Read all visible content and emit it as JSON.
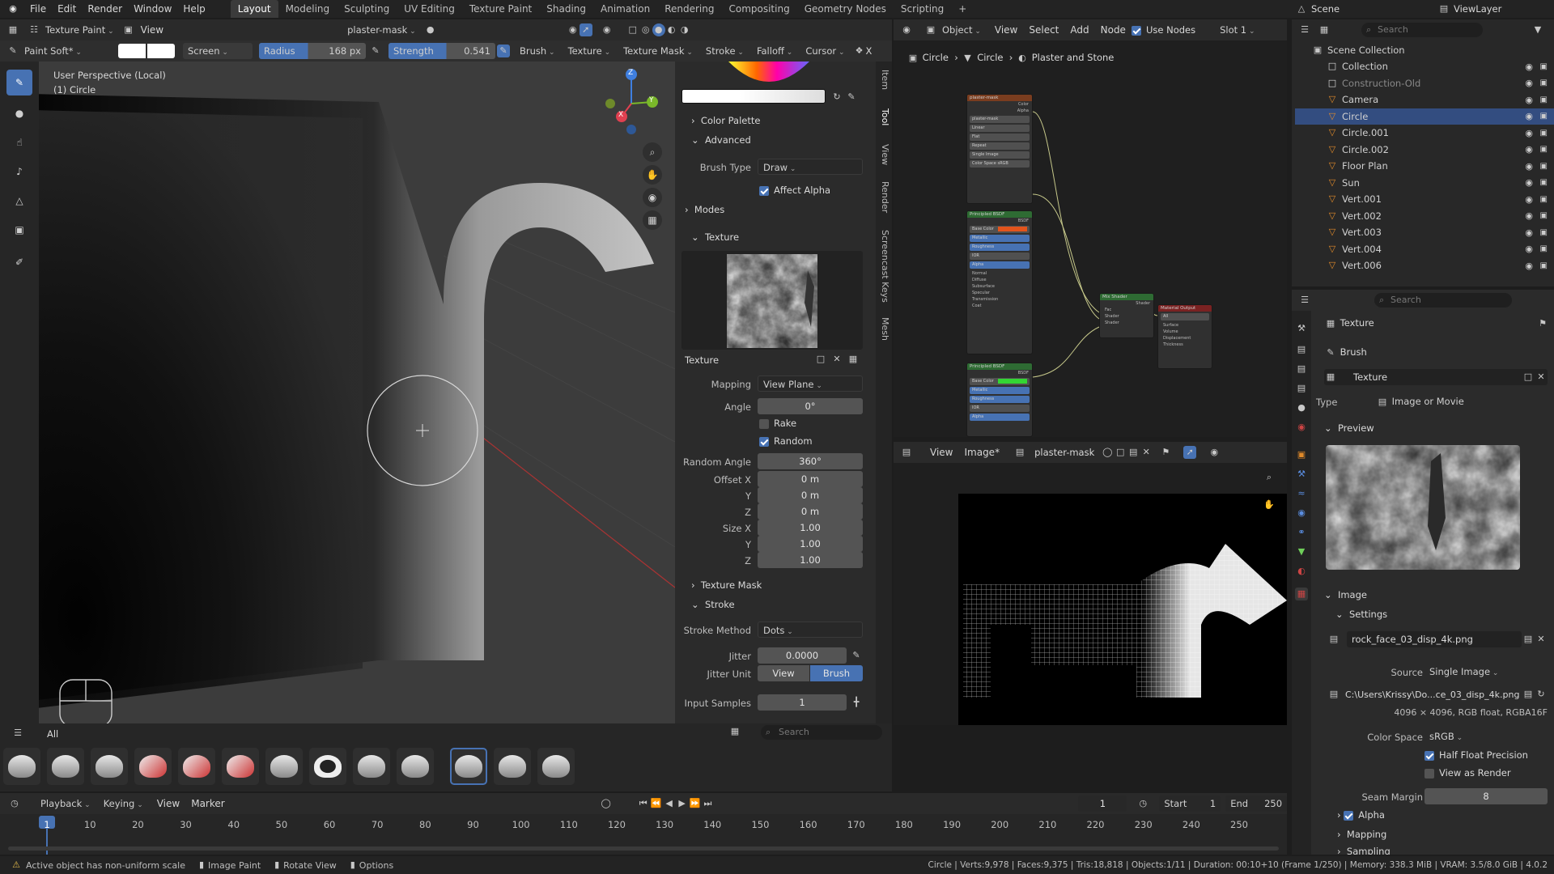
{
  "menu": [
    "File",
    "Edit",
    "Render",
    "Window",
    "Help"
  ],
  "workspaces": [
    "Layout",
    "Modeling",
    "Sculpting",
    "UV Editing",
    "Texture Paint",
    "Shading",
    "Animation",
    "Rendering",
    "Compositing",
    "Geometry Nodes",
    "Scripting"
  ],
  "active_workspace": "Layout",
  "scene": {
    "name": "Scene",
    "view_layer": "ViewLayer"
  },
  "viewport_header": {
    "mode": "Texture Paint",
    "view": "View",
    "image": "plaster-mask"
  },
  "tool_settings": {
    "brush_name": "Paint Soft*",
    "blend": "Screen",
    "radius_label": "Radius",
    "radius_value": "168 px",
    "strength_label": "Strength",
    "strength_value": "0.541",
    "menus": [
      "Brush",
      "Texture",
      "Texture Mask",
      "Stroke",
      "Falloff",
      "Cursor"
    ]
  },
  "viewport": {
    "title": "User Perspective (Local)",
    "object": "(1) Circle"
  },
  "gizmo": {
    "x": "X",
    "y": "Y",
    "z": "Z"
  },
  "n_panel": {
    "tabs": [
      "Item",
      "Tool",
      "View",
      "Render",
      "Screencast Keys",
      "Mesh"
    ],
    "color_palette": "Color Palette",
    "advanced": "Advanced",
    "brush_type_label": "Brush Type",
    "brush_type": "Draw",
    "affect_alpha": "Affect Alpha",
    "modes": "Modes",
    "texture_section": "Texture",
    "texture_name": "Texture",
    "mapping_label": "Mapping",
    "mapping": "View Plane",
    "angle_label": "Angle",
    "angle": "0°",
    "rake": "Rake",
    "random": "Random",
    "random_angle_label": "Random Angle",
    "random_angle": "360°",
    "offset_x_label": "Offset X",
    "offset_x": "0 m",
    "offset_y_label": "Y",
    "offset_y": "0 m",
    "offset_z_label": "Z",
    "offset_z": "0 m",
    "size_x_label": "Size X",
    "size_x": "1.00",
    "size_y_label": "Y",
    "size_y": "1.00",
    "size_z_label": "Z",
    "size_z": "1.00",
    "texture_mask": "Texture Mask",
    "stroke": "Stroke",
    "stroke_method_label": "Stroke Method",
    "stroke_method": "Dots",
    "jitter_label": "Jitter",
    "jitter": "0.0000",
    "jitter_unit_label": "Jitter Unit",
    "jitter_unit_view": "View",
    "jitter_unit_brush": "Brush",
    "input_samples_label": "Input Samples",
    "input_samples": "1"
  },
  "brush_shelf": {
    "filter": "All",
    "search_placeholder": "Search"
  },
  "node_editor": {
    "object": "Object",
    "view": "View",
    "select": "Select",
    "add": "Add",
    "node": "Node",
    "use_nodes": "Use Nodes",
    "slot": "Slot 1",
    "breadcrumb": [
      "Circle",
      "Circle",
      "Plaster and Stone"
    ]
  },
  "image_editor": {
    "view": "View",
    "image": "Image*",
    "image_name": "plaster-mask"
  },
  "outliner": {
    "search_placeholder": "Search",
    "root": "Scene Collection",
    "items": [
      {
        "name": "Collection",
        "level": 1
      },
      {
        "name": "Construction-Old",
        "level": 1
      },
      {
        "name": "Camera",
        "level": 1
      },
      {
        "name": "Circle",
        "level": 1,
        "selected": true
      },
      {
        "name": "Circle.001",
        "level": 1
      },
      {
        "name": "Circle.002",
        "level": 1
      },
      {
        "name": "Floor Plan",
        "level": 1
      },
      {
        "name": "Sun",
        "level": 1
      },
      {
        "name": "Vert.001",
        "level": 1
      },
      {
        "name": "Vert.002",
        "level": 1
      },
      {
        "name": "Vert.003",
        "level": 1
      },
      {
        "name": "Vert.004",
        "level": 1
      },
      {
        "name": "Vert.006",
        "level": 1
      }
    ]
  },
  "properties": {
    "search_placeholder": "Search",
    "texture_header": "Texture",
    "brush": "Brush",
    "texture_name": "Texture",
    "type_label": "Type",
    "type": "Image or Movie",
    "preview": "Preview",
    "image_section": "Image",
    "settings": "Settings",
    "image_file": "rock_face_03_disp_4k.png",
    "source_label": "Source",
    "source": "Single Image",
    "path": "C:\\Users\\Krissy\\Do...ce_03_disp_4k.png",
    "info": "4096 × 4096, RGB float, RGBA16F",
    "color_space_label": "Color Space",
    "color_space": "sRGB",
    "half_float": "Half Float Precision",
    "view_as_render": "View as Render",
    "seam_margin_label": "Seam Margin",
    "seam_margin": "8",
    "alpha": "Alpha",
    "mapping": "Mapping",
    "sampling": "Sampling"
  },
  "timeline": {
    "playback": "Playback",
    "keying": "Keying",
    "view": "View",
    "marker": "Marker",
    "current_frame": "1",
    "start_label": "Start",
    "start": "1",
    "end_label": "End",
    "end": "250",
    "ticks": [
      "1",
      "10",
      "20",
      "30",
      "40",
      "50",
      "60",
      "70",
      "80",
      "90",
      "100",
      "110",
      "120",
      "130",
      "140",
      "150",
      "160",
      "170",
      "180",
      "190",
      "200",
      "210",
      "220",
      "230",
      "240",
      "250"
    ]
  },
  "status_bar": {
    "warning": "Active object has non-uniform scale",
    "image_paint": "Image Paint",
    "rotate_view": "Rotate View",
    "options": "Options",
    "stats": "Circle | Verts:9,978 | Faces:9,375 | Tris:18,818 | Objects:1/11 | Duration: 00:10+10 (Frame 1/250) | Memory: 338.3 MiB | VRAM: 3.5/8.0 GiB | 4.0.2"
  },
  "colors": {
    "accent": "#4772b3",
    "selected_row": "#334d80",
    "base_color_swatch": "#e2541c",
    "green_swatch": "#33d633"
  }
}
